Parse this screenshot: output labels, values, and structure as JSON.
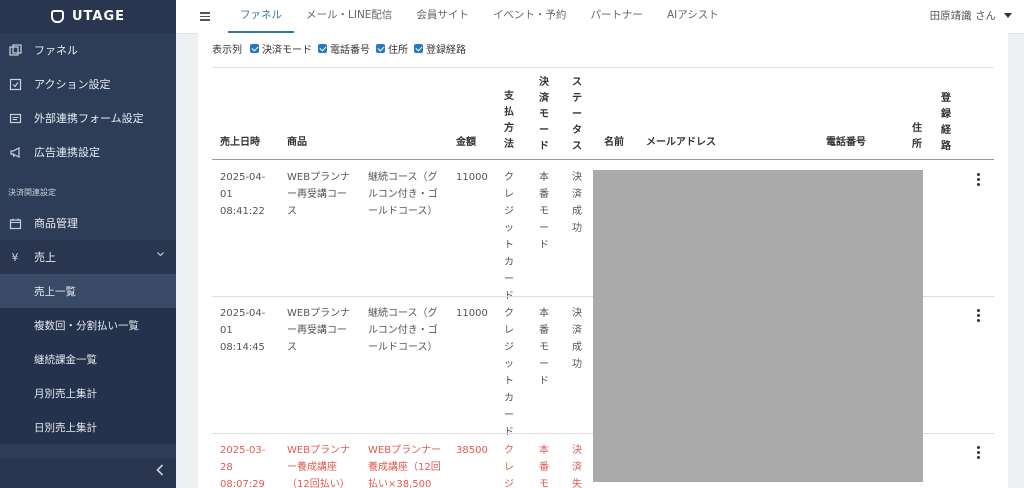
{
  "app": {
    "logo_text": "UTAGE"
  },
  "sidebar": {
    "items": [
      {
        "label": "ファネル",
        "icon": "funnel-icon"
      },
      {
        "label": "アクション設定",
        "icon": "checklist-icon"
      },
      {
        "label": "外部連携フォーム設定",
        "icon": "form-icon"
      },
      {
        "label": "広告連携設定",
        "icon": "megaphone-icon"
      }
    ],
    "section_label": "決済関連設定",
    "product_label": "商品管理",
    "sales_label": "売上",
    "yen_glyph": "¥",
    "sub_items": [
      "売上一覧",
      "複数回・分割払い一覧",
      "継続課金一覧",
      "月別売上集計",
      "日別売上集計"
    ]
  },
  "topbar": {
    "tabs": [
      "ファネル",
      "メール・LINE配信",
      "会員サイト",
      "イベント・予約",
      "パートナー",
      "AIアシスト"
    ],
    "user": "田原靖識 さん"
  },
  "columns_toggle": {
    "label": "表示列",
    "options": [
      "決済モード",
      "電話番号",
      "住所",
      "登録経路"
    ]
  },
  "table": {
    "headers": {
      "date": "売上日時",
      "product": "商品",
      "amount": "金額",
      "payment": "支払方法",
      "mode": "決済モード",
      "status": "ステータス",
      "name": "名前",
      "email": "メールアドレス",
      "phone": "電話番号",
      "address": "住所",
      "route": "登録経路"
    },
    "rows": [
      {
        "date": [
          "2025-04-",
          "01",
          "08:41:22"
        ],
        "product": [
          "WEBプランナ",
          "ー再受講コー",
          "ス"
        ],
        "plan": [
          "継続コース（グ",
          "ルコン付き・ゴ",
          "ールドコース）"
        ],
        "amount": "11000",
        "payment": "クレジットカード",
        "mode": "本番モード",
        "status": "決済成功"
      },
      {
        "date": [
          "2025-04-",
          "01",
          "08:14:45"
        ],
        "product": [
          "WEBプランナ",
          "ー再受講コー",
          "ス"
        ],
        "plan": [
          "継続コース（グ",
          "ルコン付き・ゴ",
          "ールドコース）"
        ],
        "amount": "11000",
        "payment": "クレジットカード",
        "mode": "本番モード",
        "status": "決済成功"
      },
      {
        "date": [
          "2025-03-",
          "28",
          "08:07:29"
        ],
        "product": [
          "WEBプランナ",
          "ー養成講座",
          "（12回払い）"
        ],
        "plan": [
          "WEBプランナー",
          "養成講座（12回",
          "払い×38,500"
        ],
        "amount": "38500",
        "payment": "クレジ",
        "mode": "本番モ",
        "status": "決済失"
      }
    ]
  },
  "colors": {
    "sidebar": "#2e3d57",
    "accent": "#2f7aa1",
    "checkbox": "#2676c9",
    "error_red": "#e05a52"
  }
}
